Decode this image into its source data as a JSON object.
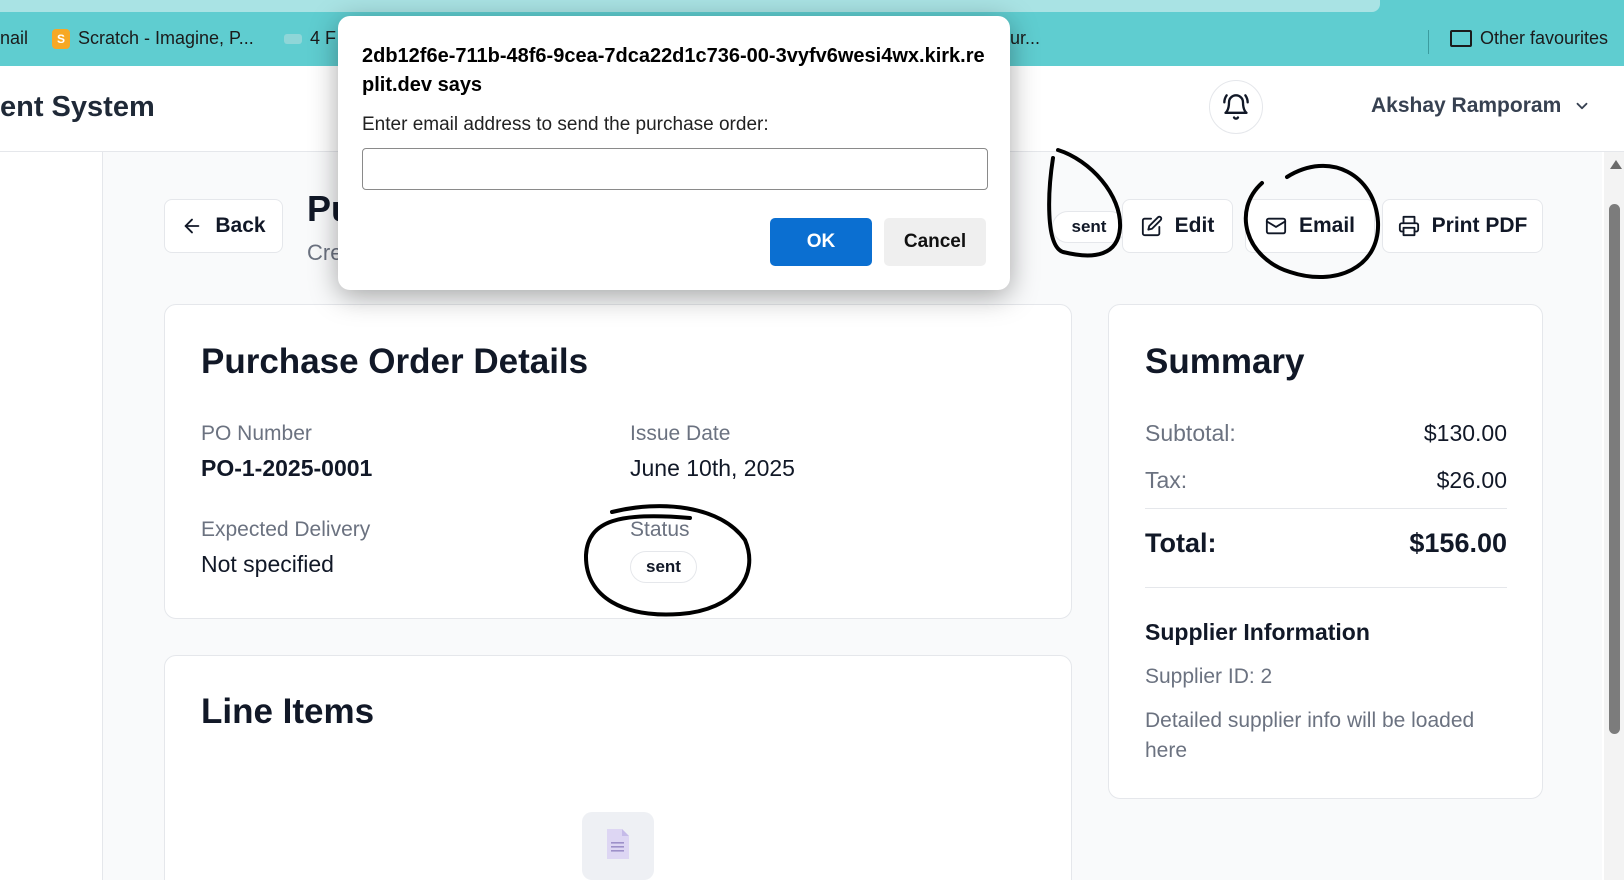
{
  "browser": {
    "bookmarks": [
      {
        "label": "nail"
      },
      {
        "label": "Scratch - Imagine, P..."
      },
      {
        "label": "4 F"
      },
      {
        "label": "ur..."
      }
    ],
    "other_favourites": "Other favourites"
  },
  "app": {
    "title": "ent System",
    "user_name": "Akshay Ramporam"
  },
  "page": {
    "back_label": "Back",
    "title_partial": "Pu",
    "subtitle_partial": "Cre",
    "status_badge": "sent",
    "edit_label": "Edit",
    "email_label": "Email",
    "print_label": "Print PDF"
  },
  "details": {
    "title": "Purchase Order Details",
    "po_number_label": "PO Number",
    "po_number": "PO-1-2025-0001",
    "issue_date_label": "Issue Date",
    "issue_date": "June 10th, 2025",
    "expected_delivery_label": "Expected Delivery",
    "expected_delivery": "Not specified",
    "status_label": "Status",
    "status": "sent"
  },
  "line_items": {
    "title": "Line Items"
  },
  "summary": {
    "title": "Summary",
    "subtotal_label": "Subtotal:",
    "subtotal": "$130.00",
    "tax_label": "Tax:",
    "tax": "$26.00",
    "total_label": "Total:",
    "total": "$156.00",
    "supplier_title": "Supplier Information",
    "supplier_id": "Supplier ID: 2",
    "supplier_note": "Detailed supplier info will be loaded here"
  },
  "dialog": {
    "title": "2db12f6e-711b-48f6-9cea-7dca22d1c736-00-3vyfv6wesi4wx.kirk.replit.dev says",
    "message": "Enter email address to send the purchase order:",
    "input_value": "",
    "ok_label": "OK",
    "cancel_label": "Cancel"
  }
}
